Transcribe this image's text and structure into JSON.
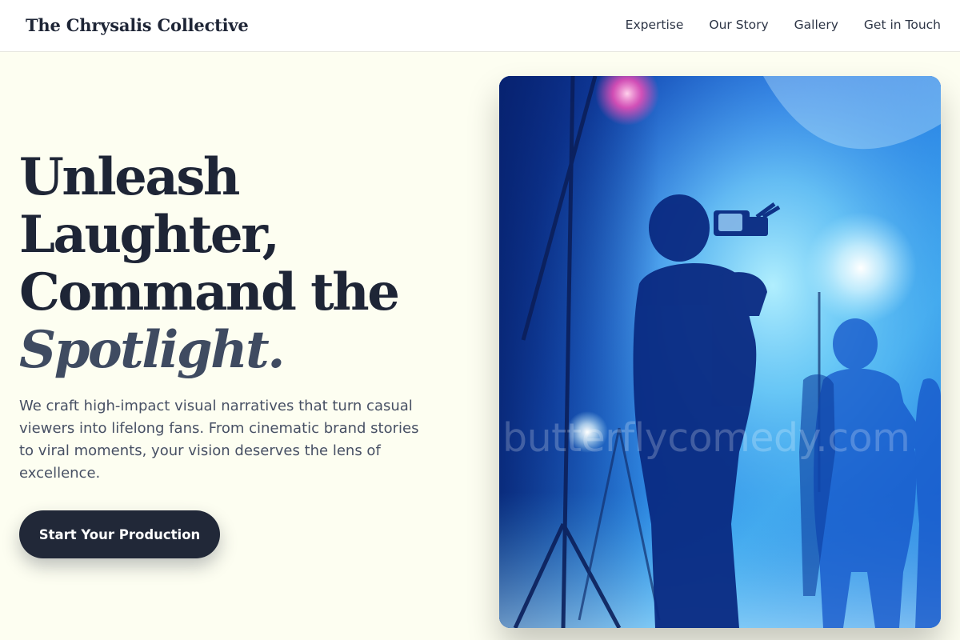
{
  "header": {
    "brand": "The Chrysalis Collective",
    "nav": [
      "Expertise",
      "Our Story",
      "Gallery",
      "Get in Touch"
    ]
  },
  "hero": {
    "title_lines": [
      "Unleash",
      "Laughter,",
      "Command the"
    ],
    "title_accent": "Spotlight.",
    "lead": "We craft high-impact visual narratives that turn casual viewers into lifelong fans. From cinematic brand stories to viral moments, your vision deserves the lens of excellence.",
    "cta_label": "Start Your Production"
  },
  "media": {
    "watermark": "butterflycomedy.com",
    "alt": "Silhouetted camera operator filming performers on a blue-lit stage"
  },
  "colors": {
    "background": "#fdfef1",
    "ink": "#1e2536",
    "accent": "#3f4b61",
    "cta": "#212838",
    "stage_blue": "#1147c6"
  }
}
